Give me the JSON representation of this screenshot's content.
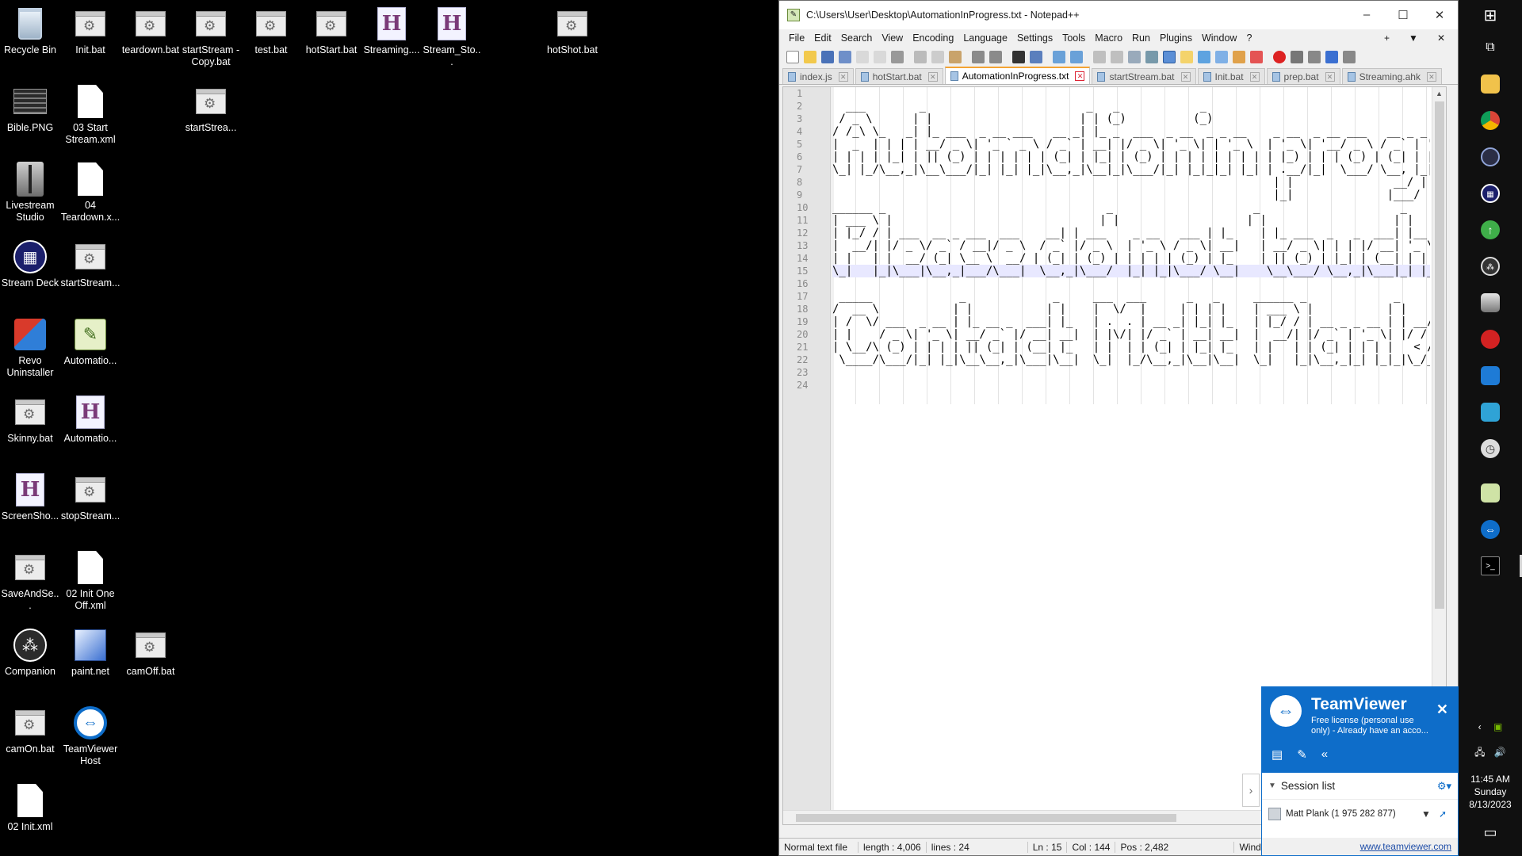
{
  "desktop": {
    "icons": [
      {
        "label": "Recycle Bin"
      },
      {
        "label": "Init.bat"
      },
      {
        "label": "teardown.bat"
      },
      {
        "label": "startStream - Copy.bat"
      },
      {
        "label": "test.bat"
      },
      {
        "label": "hotStart.bat"
      },
      {
        "label": "Streaming...."
      },
      {
        "label": "Stream_Sto..."
      },
      {
        "label": "hotShot.bat"
      },
      {
        "label": "Bible.PNG"
      },
      {
        "label": "03 Start Stream.xml"
      },
      {
        "label": "startStrea..."
      },
      {
        "label": "Livestream Studio"
      },
      {
        "label": "04 Teardown.x..."
      },
      {
        "label": "Stream Deck"
      },
      {
        "label": "startStream..."
      },
      {
        "label": "Revo Uninstaller"
      },
      {
        "label": "Automatio..."
      },
      {
        "label": "Skinny.bat"
      },
      {
        "label": "Automatio..."
      },
      {
        "label": "ScreenSho..."
      },
      {
        "label": "stopStream..."
      },
      {
        "label": "SaveAndSe..."
      },
      {
        "label": "02 Init One Off.xml"
      },
      {
        "label": "Companion"
      },
      {
        "label": "paint.net"
      },
      {
        "label": "camOff.bat"
      },
      {
        "label": "camOn.bat"
      },
      {
        "label": "TeamViewer Host"
      },
      {
        "label": "02 Init.xml"
      }
    ]
  },
  "notepad": {
    "title": "C:\\Users\\User\\Desktop\\AutomationInProgress.txt - Notepad++",
    "window_controls": [
      "–",
      "☐",
      "✕"
    ],
    "menu": [
      "File",
      "Edit",
      "Search",
      "View",
      "Encoding",
      "Language",
      "Settings",
      "Tools",
      "Macro",
      "Run",
      "Plugins",
      "Window",
      "?"
    ],
    "menu_right": [
      "+",
      "▼",
      "✕"
    ],
    "tabs": [
      {
        "label": "index.js"
      },
      {
        "label": "hotStart.bat"
      },
      {
        "label": "AutomationInProgress.txt"
      },
      {
        "label": "startStream.bat"
      },
      {
        "label": "Init.bat"
      },
      {
        "label": "prep.bat"
      },
      {
        "label": "Streaming.ahk"
      }
    ],
    "line_numbers": [
      "1",
      "2",
      "3",
      "4",
      "5",
      "6",
      "7",
      "8",
      "9",
      "10",
      "11",
      "12",
      "13",
      "14",
      "15",
      "16",
      "17",
      "18",
      "19",
      "20",
      "21",
      "22",
      "23",
      "24"
    ],
    "lines": [
      "",
      "  ___        _                        _   _            _",
      " / _ \\      | |                      | | (_)          (_)",
      "/ /_\\ \\_   _| |_ ___  _ __ ___   __ _| |_ _  ___  _ __  _ _ __    _ __  _ __ ___   __ _ _ __ ___  ___",
      "|  _  | | | | __/ _ \\| '_ ` _ \\ / _` | __| |/ _ \\| '_ \\| | '_ \\  | '_ \\| '__/ _ \\ / _` | '__/ _ \\/ __|",
      "| | | | |_| | || (_) | | | | | | (_| | |_| | (_) | | | | | | | | | |_) | | | (_) | (_| | | |  __/\\__ \\",
      "\\_| |_/\\__,_|\\__\\___/|_| |_| |_|\\__,_|\\__|_|\\___/|_| |_|_|_| |_| | .__/|_|  \\___/ \\__, |_|  \\___||___/",
      "                                                                  | |               __/ |",
      "                                                                  |_|              |___/",
      "______ _                                 _                     _                     _",
      "| ___ \\ |                               | |                   | |                   | |",
      "| |_/ / | ___  __ _ ___  ___    __| | ___    _ __   ___ | |_    | |_ ___  _   _  ___| |__",
      "|  __/| |/ _ \\/ _` / __|/ _ \\  / _` |/ _ \\  | '_ \\ / _ \\| __|   | __/ _ \\| | | |/ __| '_ \\",
      "| |   | |  __/ (_| \\__ \\  __/ | (_| | (_) | | | | | (_) | |_    | || (_) | |_| | (__| | | |",
      "\\_|   |_|\\___|\\__,_|___/\\___|  \\__,_|\\___/  |_| |_|\\___/ \\__|    \\__\\___/ \\__,_|\\___|_| |_|",
      "",
      " _____             _             _     ___  ___      _   _     ______ _             _      __  __",
      "/  __ \\           | |           | |    |  \\/  |     | | | |    | ___ \\ |           | |    / / /_/",
      "| /  \\/ ___  _ __ | |_ __ _  ___| |_   | .  . | __ _| |_| |_   | |_/ / | __ _ _ __ | | __/ / /",
      "| |    / _ \\| '_ \\| __/ _` |/ __| __|  | |\\/| |/ _` | __| __|  |  __/| |/ _` | '_ \\| |/ / / /",
      "| \\__/\\ (_) | | | | || (_| | (__| |_   | |  | | (_| | |_| |_   | |   | | (_| | | | |   < / /",
      " \\____/\\___/|_| |_|\\__\\__,_|\\___|\\__|  \\_|  |_/\\__,_|\\__|\\__|  \\_|   |_|\\__,_|_| |_|_|\\_/_/",
      "",
      ""
    ],
    "status": {
      "file_type": "Normal text file",
      "length": "length : 4,006",
      "lines": "lines : 24",
      "ln": "Ln : 15",
      "col": "Col : 144",
      "pos": "Pos : 2,482",
      "eol": "Wind"
    }
  },
  "teamviewer": {
    "brand": "TeamViewer",
    "subtitle": "Free license (personal use only) - Already have an acco...",
    "session_header": "Session list",
    "session_user": "Matt Plank (1 975 282 877)",
    "link": "www.teamviewer.com"
  },
  "tray": {
    "time": "11:45 AM",
    "day": "Sunday",
    "date": "8/13/2023"
  }
}
